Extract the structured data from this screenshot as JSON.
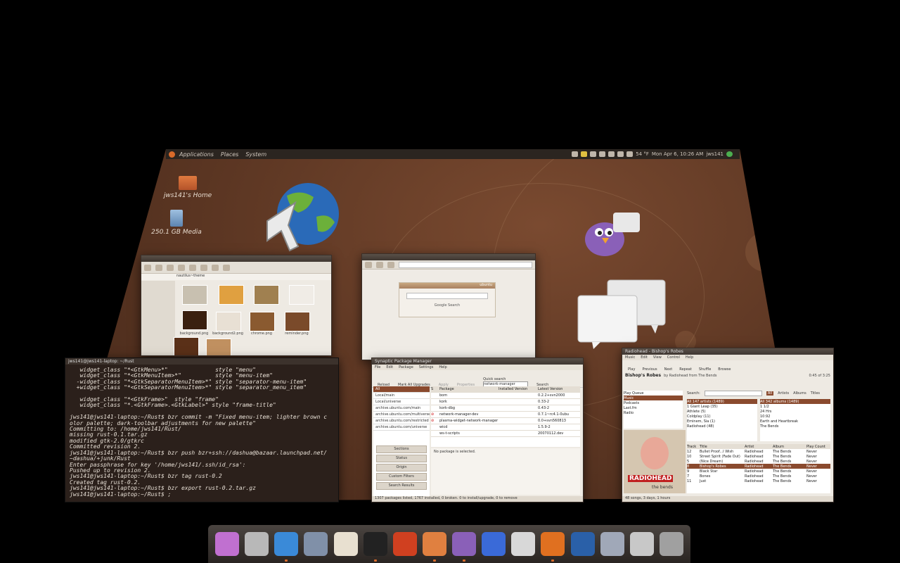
{
  "top_panel": {
    "menus": [
      "Applications",
      "Places",
      "System"
    ],
    "temperature": "54 °F",
    "clock": "Mon Apr  6, 10:26 AM",
    "user": "jws141"
  },
  "desktop_icons": [
    {
      "label": "jws141's Home",
      "icon": "home-folder-icon"
    },
    {
      "label": "250.1 GB Media",
      "icon": "usb-drive-icon"
    }
  ],
  "file_browser": {
    "address": "nautilus~theme",
    "files": [
      "background.png",
      "background2.png",
      "chrome.png",
      "reminder.png",
      "folder.png",
      "background.png",
      "checkbox.png",
      "window.png"
    ]
  },
  "browser_window": {
    "search_button": "Google Search",
    "logo": "ubuntu"
  },
  "terminal": {
    "title": "jws141@jws141-laptop: ~/Rust",
    "lines": [
      "   widget_class \"*<GtkMenu>*\"              style \"menu\"",
      "   widget_class \"*<GtkMenuItem>*\"          style \"menu-item\"",
      "  -widget_class \"*<GtkSeparatorMenuItem>*\" style \"separator-menu-item\"",
      "  +widget_class \"*<GtkSeparatorMenuItem>*\" style \"separator_menu_item\"",
      "",
      "   widget_class \"*<GtkFrame>\"  style \"frame\"",
      "   widget_class \"*.<GtkFrame>.<GtkLabel>\" style \"frame-title\"",
      "",
      "jws141@jws141-laptop:~/Rust$ bzr commit -m \"Fixed menu-item; lighter brown c",
      "olor palette; dark-toolbar adjustments for new palette\"",
      "Committing to: /home/jws141/Rust/",
      "missing rust-0.1.tar.gz",
      "modified gtk-2.0/gtkrc",
      "Committed revision 2.",
      "jws141@jws141-laptop:~/Rust$ bzr push bzr+ssh://dashua@bazaar.launchpad.net/",
      "~dashua/+junk/Rust",
      "Enter passphrase for key '/home/jws141/.ssh/id_rsa':",
      "Pushed up to revision 2.",
      "jws141@jws141-laptop:~/Rust$ bzr tag rust-0.2",
      "Created tag rust-0.2.",
      "jws141@jws141-laptop:~/Rust$ bzr export rust-0.2.tar.gz",
      "jws141@jws141-laptop:~/Rust$ ;"
    ]
  },
  "synaptic": {
    "title": "Synaptic Package Manager",
    "menu": [
      "File",
      "Edit",
      "Package",
      "Settings",
      "Help"
    ],
    "toolbar": [
      "Reload",
      "Mark All Upgrades",
      "Apply",
      "Properties",
      "Search"
    ],
    "quick_search_label": "Quick search",
    "quick_search_value": "network-manager",
    "sources": [
      "All",
      "Local/main",
      "Local/universe",
      "archive.ubuntu.com/main",
      "archive.ubuntu.com/multiverse",
      "archive.ubuntu.com/restricted",
      "archive.ubuntu.com/universe"
    ],
    "columns": [
      "S",
      "Package",
      "Installed Version",
      "Latest Version"
    ],
    "packages": [
      {
        "name": "bom",
        "latest": "0.2.2+svn2000"
      },
      {
        "name": "kork",
        "latest": "0.33-2"
      },
      {
        "name": "kork-dbg",
        "latest": "0.43-2"
      },
      {
        "name": "network-manager-dev",
        "latest": "0.7.1~rc4.1-0ubu"
      },
      {
        "name": "plasma-widget-network-manager",
        "latest": "0.0+svn560813"
      },
      {
        "name": "wicd",
        "latest": "1.5.9-2"
      },
      {
        "name": "ws-t-scripts",
        "latest": "20070112.dev"
      }
    ],
    "filter_buttons": [
      "Sections",
      "Status",
      "Origin",
      "Custom Filters",
      "Search Results"
    ],
    "no_selection": "No package is selected.",
    "status": "1307 packages listed, 1767 installed, 0 broken. 0 to install/upgrade, 0 to remove"
  },
  "rhythmbox": {
    "title": "Radiohead - Bishop's Robes",
    "menu": [
      "Music",
      "Edit",
      "View",
      "Control",
      "Help"
    ],
    "toolbar": [
      "Play",
      "Previous",
      "Next",
      "Repeat",
      "Shuffle",
      "Browse"
    ],
    "now_playing": "Bishop's Robes",
    "now_playing_by": "by Radiohead from The Bends",
    "time": "0:45 of 3:25",
    "library": [
      "Play Queue",
      "Music",
      "Podcasts",
      "Last.fm",
      "Radio"
    ],
    "search_label": "Search:",
    "filter_tabs": [
      "All",
      "Artists",
      "Albums",
      "Titles"
    ],
    "artists": [
      "All 147 artists (1489)",
      "1 Giant Leap (35)",
      "Athlete (5)",
      "Coldplay (11)",
      "Eminem, Sia (1)",
      "Radiohead (48)"
    ],
    "albums": [
      "All 342 albums (1489)",
      "1 1/2",
      "24 Hrs",
      "10:92",
      "Earth and Heartbreak",
      "The Bends"
    ],
    "columns": [
      "Track",
      "Title",
      "Artist",
      "Album",
      "Play Count"
    ],
    "tracks": [
      {
        "no": "12",
        "title": "Bullet Proof...I Wish",
        "artist": "Radiohead",
        "album": "The Bends",
        "plays": "Never"
      },
      {
        "no": "10",
        "title": "Street Spirit (Fade Out)",
        "artist": "Radiohead",
        "album": "The Bends",
        "plays": "Never"
      },
      {
        "no": "5",
        "title": "(Nice Dream)",
        "artist": "Radiohead",
        "album": "The Bends",
        "plays": "Never"
      },
      {
        "no": "8",
        "title": "Bishop's Robes",
        "artist": "Radiohead",
        "album": "The Bends",
        "plays": "Never"
      },
      {
        "no": "9",
        "title": "Black Star",
        "artist": "Radiohead",
        "album": "The Bends",
        "plays": "Never"
      },
      {
        "no": "7",
        "title": "Bones",
        "artist": "Radiohead",
        "album": "The Bends",
        "plays": "Never"
      },
      {
        "no": "11",
        "title": "Just",
        "artist": "Radiohead",
        "album": "The Bends",
        "plays": "Never"
      }
    ],
    "album_art_text": "RADIOHEAD",
    "album_art_sub": "the bends",
    "status": "48 songs, 3 days, 1 hours"
  },
  "dock": {
    "items": [
      "Purple-Pixie",
      "Time Machine",
      "Web Browser",
      "System Settings",
      "Music Player",
      "Terminal",
      "GIMP",
      "Home Folder",
      "Pidgin",
      "Banshee",
      "Document",
      "Firefox",
      "Globe",
      "Package Manager",
      "Clock",
      "Trash"
    ]
  },
  "colors": {
    "desktop": "#5a3522",
    "accent": "#d86a2a",
    "panel": "#2b2520"
  }
}
